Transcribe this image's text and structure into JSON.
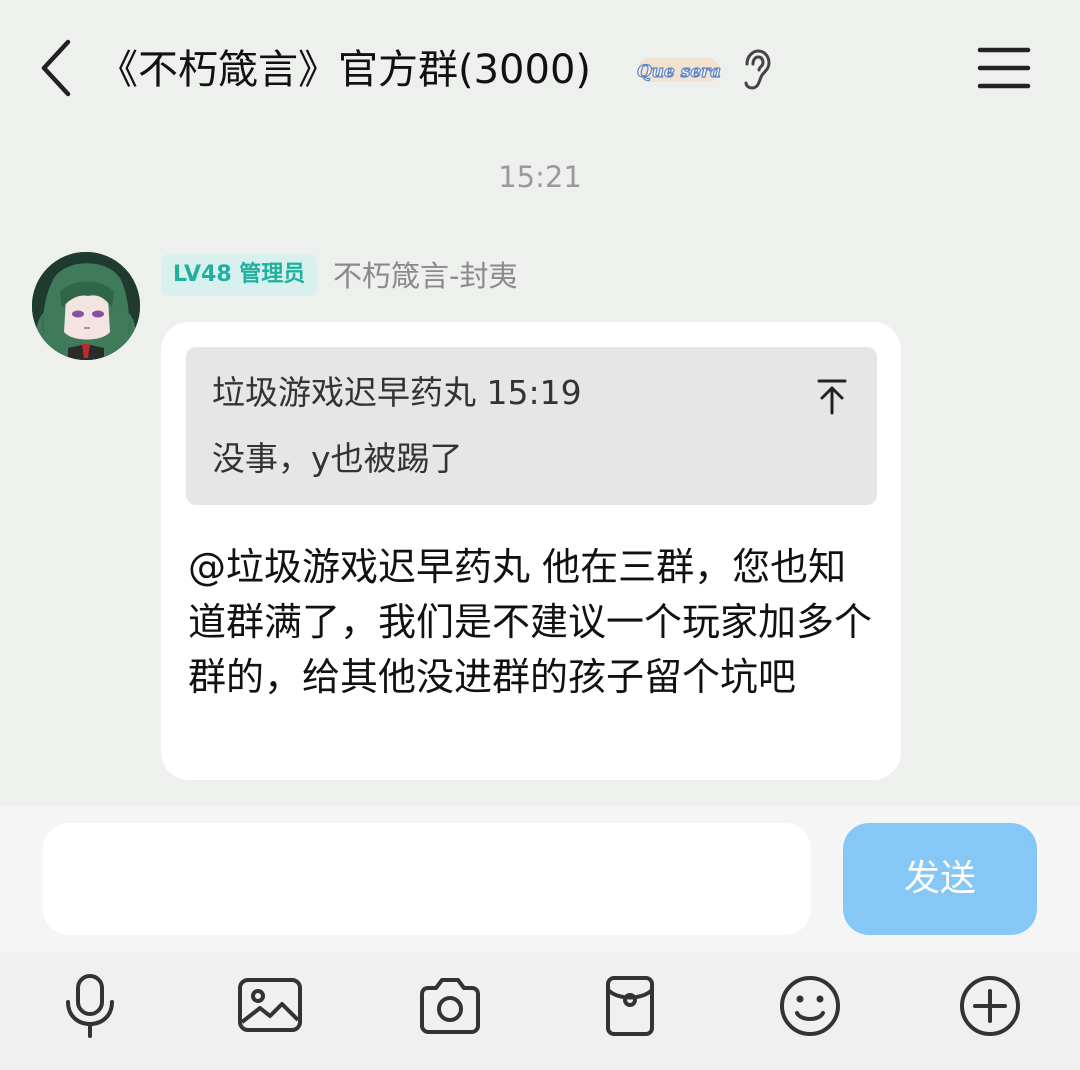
{
  "header": {
    "title": "《不朽箴言》官方群(3000)",
    "badge_text": "Que sera"
  },
  "chat": {
    "time_divider": "15:21",
    "message": {
      "level_badge": "LV48 管理员",
      "sender": "不朽箴言-封夷",
      "quote": {
        "header": "垃圾游戏迟早药丸 15:19",
        "text": "没事，y也被踢了"
      },
      "mention": "@垃圾游戏迟早药丸",
      "body": " 他在三群，您也知道群满了，我们是不建议一个玩家加多个群的，给其他没进群的孩子留个坑吧"
    }
  },
  "composer": {
    "input_value": "",
    "send_label": "发送"
  },
  "toolbar": {
    "icons": [
      "microphone-icon",
      "image-icon",
      "camera-icon",
      "red-packet-icon",
      "emoji-icon",
      "plus-icon"
    ]
  },
  "colors": {
    "background": "#eef0ee",
    "send_button": "#86c8f5",
    "level_badge_bg": "#d8f1ee",
    "level_badge_text": "#1fb0a0"
  }
}
